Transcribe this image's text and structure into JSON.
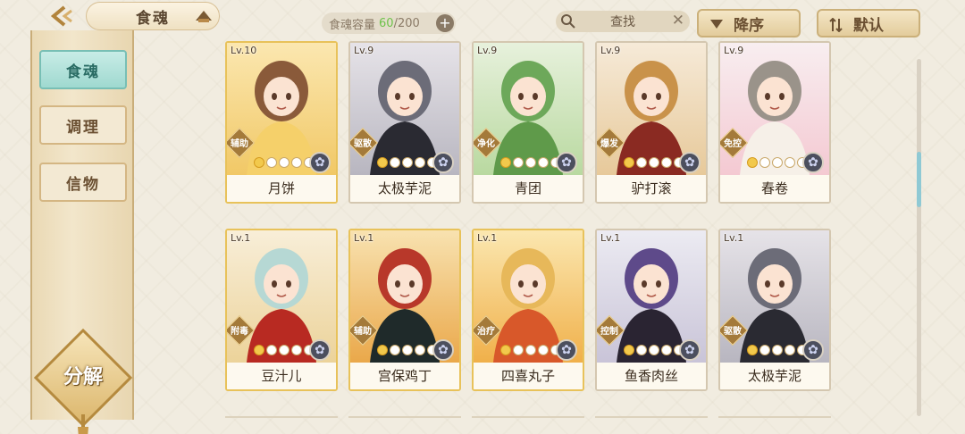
{
  "header": {
    "title": "食魂",
    "capacity_label": "食魂容量",
    "capacity_current": "60",
    "capacity_total": "/200",
    "search_label": "查找",
    "sort_order_label": "降序",
    "sort_default_label": "默认"
  },
  "sidebar": {
    "items": [
      {
        "label": "食魂",
        "active": true
      },
      {
        "label": "调理",
        "active": false
      },
      {
        "label": "信物",
        "active": false
      }
    ],
    "decompose_label": "分解"
  },
  "cards": [
    {
      "level": "Lv.10",
      "name": "月饼",
      "role": "辅助",
      "stars": 1,
      "theme": "gold"
    },
    {
      "level": "Lv.9",
      "name": "太极芋泥",
      "role": "驱散",
      "stars": 1,
      "theme": "dark"
    },
    {
      "level": "Lv.9",
      "name": "青团",
      "role": "净化",
      "stars": 1,
      "theme": "green"
    },
    {
      "level": "Lv.9",
      "name": "驴打滚",
      "role": "爆发",
      "stars": 1,
      "theme": "warm"
    },
    {
      "level": "Lv.9",
      "name": "春卷",
      "role": "免控",
      "stars": 1,
      "theme": "floral"
    },
    {
      "level": "Lv.1",
      "name": "豆汁儿",
      "role": "附毒",
      "stars": 1,
      "theme": "teal"
    },
    {
      "level": "Lv.1",
      "name": "宫保鸡丁",
      "role": "辅助",
      "stars": 1,
      "theme": "red"
    },
    {
      "level": "Lv.1",
      "name": "四喜丸子",
      "role": "治疗",
      "stars": 1,
      "theme": "orange"
    },
    {
      "level": "Lv.1",
      "name": "鱼香肉丝",
      "role": "控制",
      "stars": 1,
      "theme": "purple"
    },
    {
      "level": "Lv.1",
      "name": "太极芋泥",
      "role": "驱散",
      "stars": 1,
      "theme": "dark"
    }
  ],
  "colors": {
    "accent_teal": "#9fd9d0",
    "gold_border": "#e8c25a",
    "capacity_current": "#6ec24a"
  }
}
